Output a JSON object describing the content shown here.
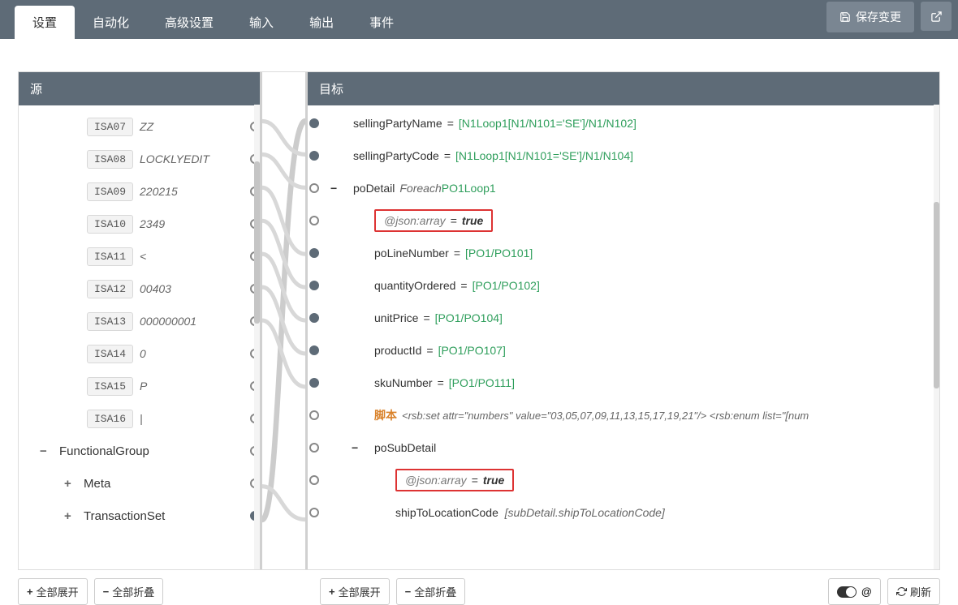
{
  "topbar": {
    "tabs": [
      "设置",
      "自动化",
      "高级设置",
      "输入",
      "输出",
      "事件"
    ],
    "active_tab_index": 0,
    "save": "保存变更"
  },
  "panels": {
    "source_title": "源",
    "target_title": "目标"
  },
  "source": {
    "isa": [
      {
        "code": "ISA07",
        "value": "ZZ"
      },
      {
        "code": "ISA08",
        "value": "LOCKLYEDIT"
      },
      {
        "code": "ISA09",
        "value": "220215"
      },
      {
        "code": "ISA10",
        "value": "2349"
      },
      {
        "code": "ISA11",
        "value": "<"
      },
      {
        "code": "ISA12",
        "value": "00403"
      },
      {
        "code": "ISA13",
        "value": "000000001"
      },
      {
        "code": "ISA14",
        "value": "0"
      },
      {
        "code": "ISA15",
        "value": "P"
      },
      {
        "code": "ISA16",
        "value": "|"
      }
    ],
    "groups": [
      {
        "expander": "−",
        "label": "FunctionalGroup"
      },
      {
        "expander": "+",
        "label": "Meta",
        "indent": true
      },
      {
        "expander": "+",
        "label": "TransactionSet",
        "indent": true
      }
    ]
  },
  "target": {
    "rows": [
      {
        "type": "assign",
        "filled": true,
        "name": "sellingPartyName",
        "expr": "[N1Loop1[N1/N101='SE']/N1/N102]"
      },
      {
        "type": "assign",
        "filled": true,
        "name": "sellingPartyCode",
        "expr": "[N1Loop1[N1/N101='SE']/N1/N104]"
      },
      {
        "type": "foreach",
        "filled": false,
        "expander": "−",
        "name": "poDetail",
        "foreach": "Foreach",
        "expr": "PO1Loop1"
      },
      {
        "type": "attr",
        "filled": false,
        "indent": 1,
        "attr_name": "@json:array",
        "attr_val": "true"
      },
      {
        "type": "assign",
        "filled": true,
        "indent": 1,
        "name": "poLineNumber",
        "expr": "[PO1/PO101]"
      },
      {
        "type": "assign",
        "filled": true,
        "indent": 1,
        "name": "quantityOrdered",
        "expr": "[PO1/PO102]"
      },
      {
        "type": "assign",
        "filled": true,
        "indent": 1,
        "name": "unitPrice",
        "expr": "[PO1/PO104]"
      },
      {
        "type": "assign",
        "filled": true,
        "indent": 1,
        "name": "productId",
        "expr": "[PO1/PO107]"
      },
      {
        "type": "assign",
        "filled": true,
        "indent": 1,
        "name": "skuNumber",
        "expr": "[PO1/PO111]"
      },
      {
        "type": "script",
        "filled": false,
        "indent": 1,
        "label": "脚本",
        "body": "<rsb:set attr=\"numbers\" value=\"03,05,07,09,11,13,15,17,19,21\"/>  <rsb:enum list=\"[num"
      },
      {
        "type": "group",
        "filled": false,
        "expander": "−",
        "indent": 1,
        "name": "poSubDetail"
      },
      {
        "type": "attr",
        "filled": false,
        "indent": 2,
        "attr_name": "@json:array",
        "attr_val": "true"
      },
      {
        "type": "sub",
        "filled": false,
        "indent": 2,
        "name": "shipToLocationCode",
        "sub": "[subDetail.shipToLocationCode]"
      }
    ]
  },
  "footer": {
    "expand_all": "全部展开",
    "collapse_all": "全部折叠",
    "at_symbol": "@",
    "refresh": "刷新"
  }
}
